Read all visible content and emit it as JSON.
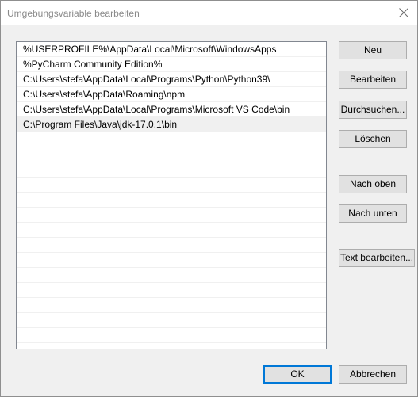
{
  "window": {
    "title": "Umgebungsvariable bearbeiten"
  },
  "list": {
    "items": [
      "%USERPROFILE%\\AppData\\Local\\Microsoft\\WindowsApps",
      "%PyCharm Community Edition%",
      "C:\\Users\\stefa\\AppData\\Local\\Programs\\Python\\Python39\\",
      "C:\\Users\\stefa\\AppData\\Roaming\\npm",
      "C:\\Users\\stefa\\AppData\\Local\\Programs\\Microsoft VS Code\\bin",
      "C:\\Program Files\\Java\\jdk-17.0.1\\bin"
    ],
    "selected_index": 5
  },
  "buttons": {
    "new": "Neu",
    "edit": "Bearbeiten",
    "browse": "Durchsuchen...",
    "delete": "Löschen",
    "move_up": "Nach oben",
    "move_down": "Nach unten",
    "edit_text": "Text bearbeiten...",
    "ok": "OK",
    "cancel": "Abbrechen"
  },
  "colors": {
    "accent": "#0078d7",
    "selection": "#f0f0f0",
    "dialog_background": "#f0f0f0"
  },
  "icons": {
    "close": "close-icon"
  }
}
